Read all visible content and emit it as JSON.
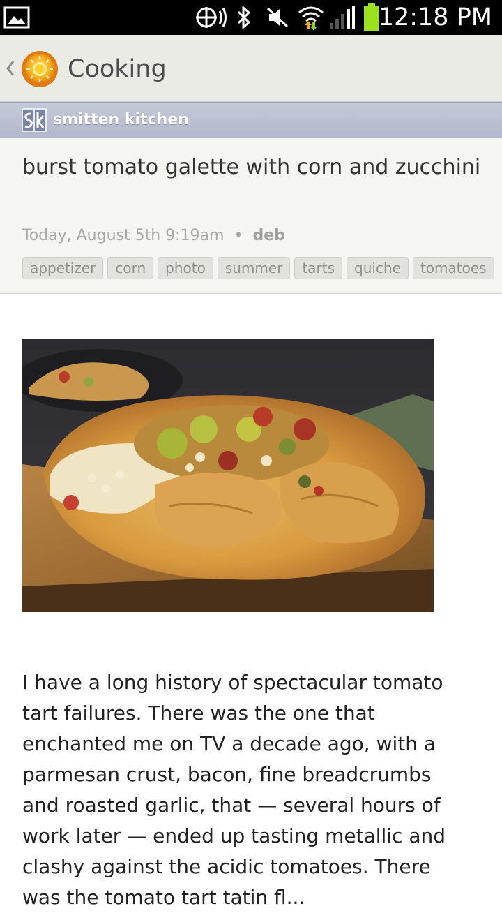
{
  "status_bar": {
    "time": "12:18 PM",
    "icons": [
      "gallery-icon",
      "location-icon",
      "bluetooth-icon",
      "mute-icon",
      "wifi-icon",
      "signal-icon",
      "battery-icon"
    ]
  },
  "action_bar": {
    "title": "Cooking",
    "icons": [
      "back-chevron-icon",
      "app-logo-icon"
    ]
  },
  "source": {
    "name": "smitten kitchen"
  },
  "article": {
    "title": "burst tomato galette with corn and zucchini",
    "date": "Today, August 5th 9:19am",
    "separator": "•",
    "author": "deb",
    "tags": [
      "appetizer",
      "corn",
      "photo",
      "summer",
      "tarts",
      "quiche",
      "tomatoes"
    ],
    "body": "I have a long history of spectacular tomato tart failures. There was the one that enchanted me on TV a decade ago, with a parmesan crust, bacon, fine breadcrumbs and roasted garlic, that — several hours of work later — ended up tasting metallic and clashy against the acidic tomatoes. There was the tomato tart tatin fl..."
  },
  "colors": {
    "status_bg": "#000000",
    "action_bar_bg": "#ebebe6",
    "source_bar_bg": "#b8bdd0",
    "header_bg": "#f5f5f1",
    "battery": "#9be11f"
  }
}
